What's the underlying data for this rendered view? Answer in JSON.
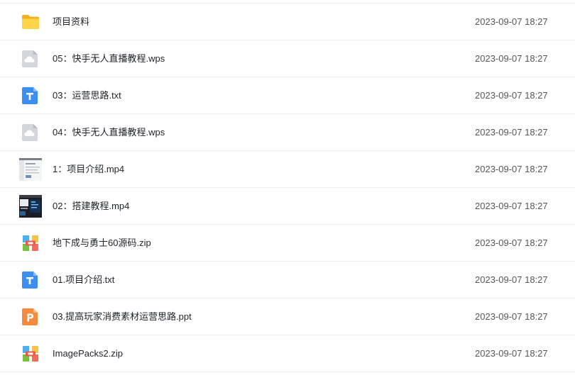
{
  "files": [
    {
      "name": "项目资料",
      "time": "2023-09-07 18:27",
      "icon": "folder-icon"
    },
    {
      "name": "05：快手无人直播教程.wps",
      "time": "2023-09-07 18:27",
      "icon": "cloud-file-icon"
    },
    {
      "name": "03：运营思路.txt",
      "time": "2023-09-07 18:27",
      "icon": "txt-file-icon"
    },
    {
      "name": "04：快手无人直播教程.wps",
      "time": "2023-09-07 18:27",
      "icon": "cloud-file-icon"
    },
    {
      "name": "1：项目介绍.mp4",
      "time": "2023-09-07 18:27",
      "icon": "video-thumbnail-icon"
    },
    {
      "name": "02：搭建教程.mp4",
      "time": "2023-09-07 18:27",
      "icon": "video-thumbnail-icon"
    },
    {
      "name": "地下成与勇士60源码.zip",
      "time": "2023-09-07 18:27",
      "icon": "zip-file-icon"
    },
    {
      "name": "01.项目介绍.txt",
      "time": "2023-09-07 18:27",
      "icon": "txt-file-icon"
    },
    {
      "name": "03.提高玩家消费素材运营思路.ppt",
      "time": "2023-09-07 18:27",
      "icon": "ppt-file-icon"
    },
    {
      "name": "ImagePacks2.zip",
      "time": "2023-09-07 18:27",
      "icon": "zip-file-icon"
    }
  ],
  "colors": {
    "folder": "#f7c02f",
    "txt": "#3d8ef2",
    "ppt": "#f5893d",
    "cloud": "#c9ccd2"
  }
}
